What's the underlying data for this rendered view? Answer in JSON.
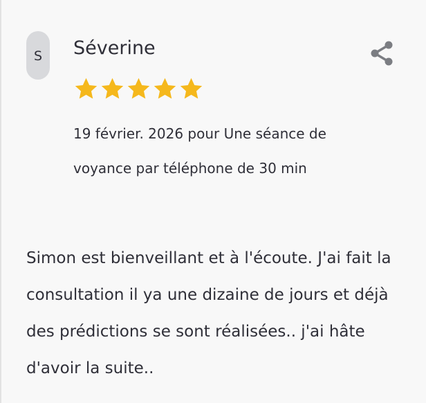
{
  "review": {
    "avatar_letter": "S",
    "reviewer_name": "Séverine",
    "rating": 5,
    "rating_max": 5,
    "star_color": "#f5b81c",
    "meta": "19 février. 2026 pour Une séance de voyance par téléphone de 30 min",
    "body": "Simon est bienveillant et à l'écoute. J'ai fait la consultation il ya une dizaine de jours et déjà des prédictions se sont réalisées.. j'ai hâte d'avoir la suite..",
    "share_icon": "share-icon"
  }
}
